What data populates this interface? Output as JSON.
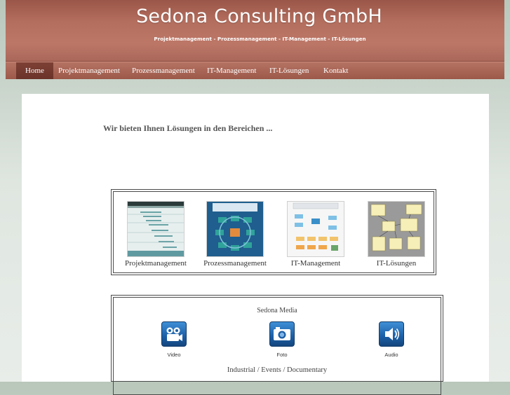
{
  "header": {
    "brand": "Sedona Consulting GmbH",
    "tagline": "Projektmanagement - Prozessmanagement - IT-Management - IT-Lösungen"
  },
  "nav": {
    "items": [
      {
        "label": "Home",
        "active": true
      },
      {
        "label": "Projektmanagement"
      },
      {
        "label": "Prozessmanagement"
      },
      {
        "label": "IT-Management"
      },
      {
        "label": "IT-Lösungen"
      },
      {
        "label": "Kontakt"
      }
    ]
  },
  "main": {
    "headline": "Wir bieten Ihnen Lösungen in den Bereichen ...",
    "services": [
      {
        "label": "Projektmanagement",
        "icon": "gantt-chart-thumbnail"
      },
      {
        "label": "Prozessmanagement",
        "icon": "process-diagram-thumbnail"
      },
      {
        "label": "IT-Management",
        "icon": "flowchart-thumbnail"
      },
      {
        "label": "IT-Lösungen",
        "icon": "uml-diagram-thumbnail"
      }
    ],
    "media": {
      "title": "Sedona Media",
      "items": [
        {
          "label": "Video",
          "icon": "video-camera-icon"
        },
        {
          "label": "Foto",
          "icon": "photo-camera-icon"
        },
        {
          "label": "Audio",
          "icon": "speaker-icon"
        }
      ],
      "footer": "Industrial / Events / Documentary"
    }
  },
  "colors": {
    "header": "#b46e5e",
    "nav_active": "#6a3329",
    "media_icon": "#1c5fa6"
  }
}
